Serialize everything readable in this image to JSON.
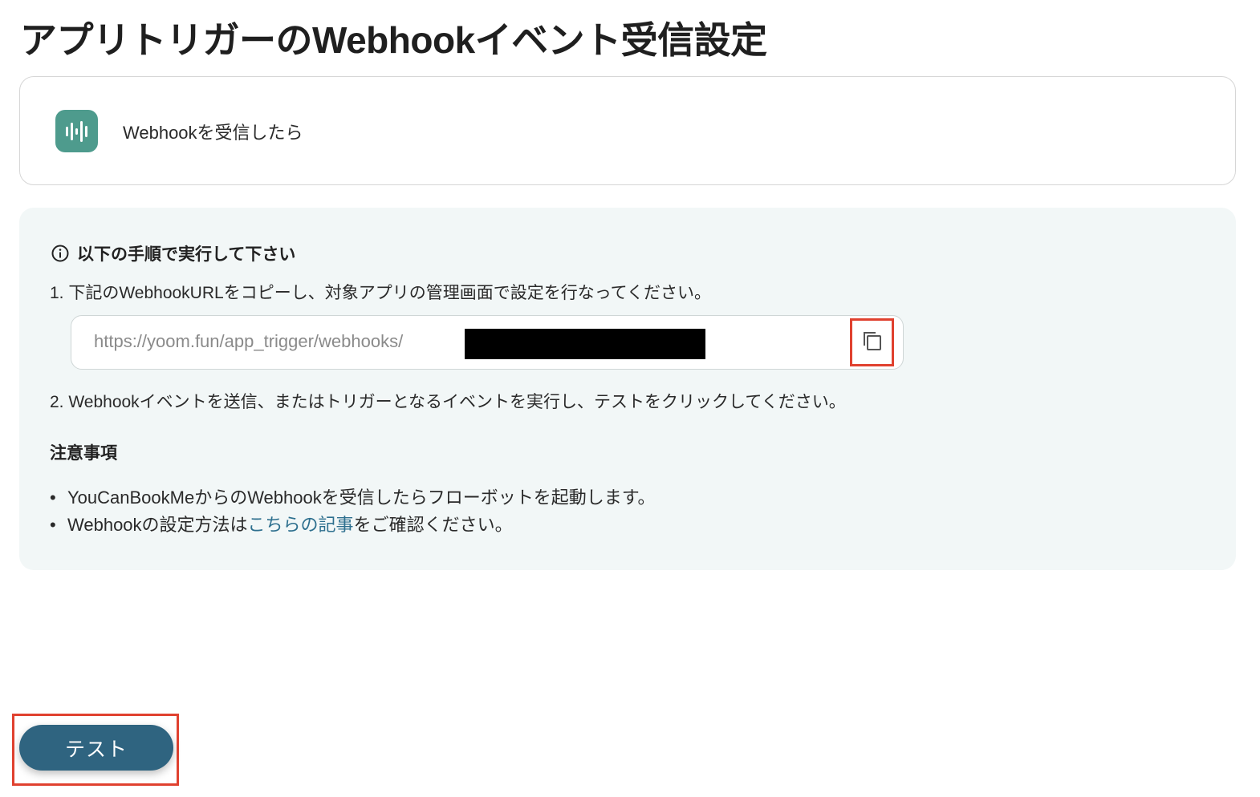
{
  "page": {
    "title": "アプリトリガーのWebhookイベント受信設定"
  },
  "trigger_card": {
    "icon": "webhook-app-icon",
    "label": "Webhookを受信したら"
  },
  "instructions": {
    "heading": "以下の手順で実行して下さい",
    "step1": "1. 下記のWebhookURLをコピーし、対象アプリの管理画面で設定を行なってください。",
    "url_value": "https://yoom.fun/app_trigger/webhooks/",
    "copy_icon": "copy-icon",
    "step2": "2. Webhookイベントを送信、またはトリガーとなるイベントを実行し、テストをクリックしてください。"
  },
  "notes": {
    "heading": "注意事項",
    "item1": "YouCanBookMeからのWebhookを受信したらフローボットを起動します。",
    "item2_prefix": "Webhookの設定方法は",
    "item2_link": "こちらの記事",
    "item2_suffix": "をご確認ください。"
  },
  "footer": {
    "test_label": "テスト"
  },
  "colors": {
    "accent": "#2f6480",
    "highlight": "#e0412f",
    "panel_bg": "#f2f7f7",
    "app_icon_bg": "#4e9b8d",
    "link": "#2d6f8e"
  }
}
